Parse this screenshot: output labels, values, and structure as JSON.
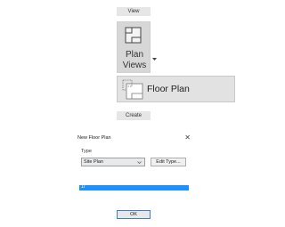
{
  "ribbon": {
    "view_tab": "View",
    "plan_views_line1": "Plan",
    "plan_views_line2": "Views",
    "floor_plan_label": "Floor Plan",
    "create_tab": "Create"
  },
  "dialog": {
    "title": "New Floor Plan",
    "close_glyph": "✕",
    "type_label": "Type",
    "type_selected": "Site Plan",
    "edit_type_label": "Edit Type...",
    "list_row_text": "1/",
    "ok_label": "OK"
  },
  "colors": {
    "selection": "#1e90ff",
    "ok_border": "#3c7fd1"
  }
}
